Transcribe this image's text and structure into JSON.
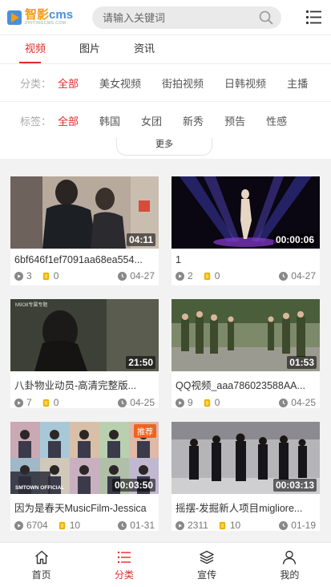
{
  "header": {
    "logo_cn": "智影",
    "logo_en": "cms",
    "logo_sub": "ZHIYINGCMS.COM",
    "search_placeholder": "请输入关键词"
  },
  "tabs": [
    {
      "label": "视频",
      "active": true
    },
    {
      "label": "图片",
      "active": false
    },
    {
      "label": "资讯",
      "active": false
    }
  ],
  "filter": {
    "category_label": "分类：",
    "categories": [
      "全部",
      "美女视频",
      "街拍视频",
      "日韩视频",
      "主播"
    ],
    "tag_label": "标签：",
    "tags": [
      "全部",
      "韩国",
      "女团",
      "新秀",
      "预告",
      "性感"
    ],
    "more_label": "更多"
  },
  "videos": [
    {
      "title": "6bf646f1ef7091aa68ea554...",
      "duration": "04:11",
      "views": "3",
      "coins": "0",
      "date": "04-27"
    },
    {
      "title": "1",
      "duration": "00:00:06",
      "views": "2",
      "coins": "0",
      "date": "04-27"
    },
    {
      "title": "八卦物业动员-高清完整版...",
      "duration": "21:50",
      "views": "7",
      "coins": "0",
      "date": "04-25"
    },
    {
      "title": "QQ视频_aaa786023588AA...",
      "duration": "01:53",
      "views": "9",
      "coins": "0",
      "date": "04-25"
    },
    {
      "title": "因为是春天MusicFilm-Jessica",
      "duration": "00:03:50",
      "views": "6704",
      "coins": "10",
      "date": "01-31",
      "badge": "推荐"
    },
    {
      "title": "摇摆-发掘新人项目migliore...",
      "duration": "00:03:13",
      "views": "2311",
      "coins": "10",
      "date": "01-19"
    }
  ],
  "thumb_watermark": "M9O8专属专题",
  "thumb_caption": "SMTOWN OFFICIAL",
  "bottom_nav": [
    {
      "label": "首页",
      "icon": "home-icon",
      "active": false
    },
    {
      "label": "分类",
      "icon": "list-icon",
      "active": true
    },
    {
      "label": "宣传",
      "icon": "layers-icon",
      "active": false
    },
    {
      "label": "我的",
      "icon": "user-icon",
      "active": false
    }
  ],
  "colors": {
    "accent": "#e02b2b",
    "logo_orange": "#f39c12",
    "logo_blue": "#4a90d9",
    "badge": "#f0641e"
  }
}
